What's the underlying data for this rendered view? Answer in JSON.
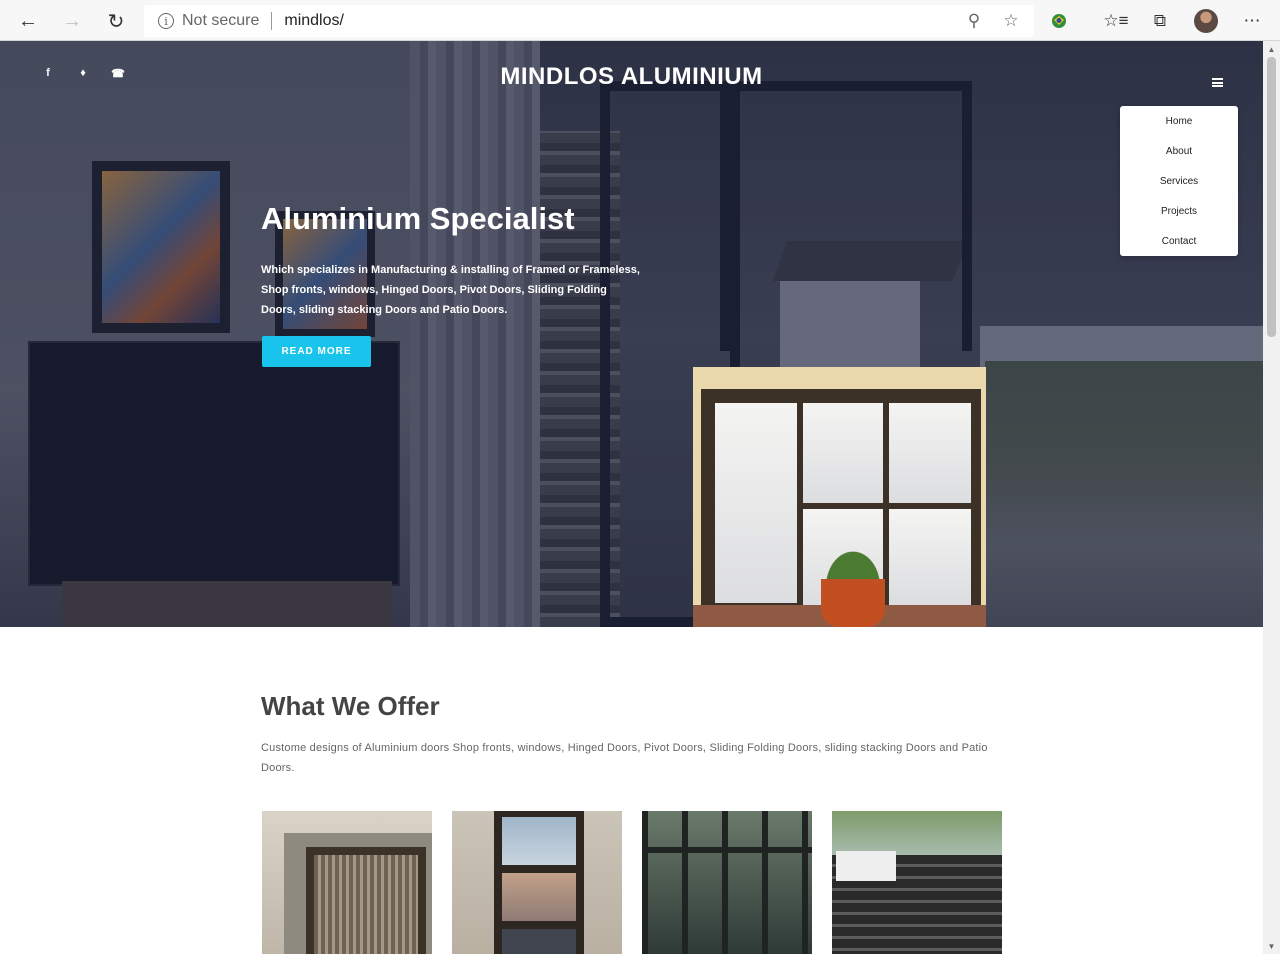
{
  "browser": {
    "security_label": "Not secure",
    "url": "mindlos/"
  },
  "site": {
    "brand": "MINDLOS ALUMINIUM",
    "social": [
      "facebook-icon",
      "twitter-icon",
      "whatsapp-icon"
    ],
    "menu": [
      "Home",
      "About",
      "Services",
      "Projects",
      "Contact"
    ]
  },
  "hero": {
    "title": "Aluminium Specialist",
    "text": "Which specializes in Manufacturing & installing of Framed or Frameless, Shop fronts, windows, Hinged Doors, Pivot Doors, Sliding Folding Doors, sliding stacking Doors and Patio Doors.",
    "button": "READ MORE",
    "button_color": "#19c4ec"
  },
  "offer": {
    "title": "What We Offer",
    "text": "Custome designs of Aluminium doors Shop fronts, windows, Hinged Doors, Pivot Doors, Sliding Folding Doors, sliding stacking Doors and Patio Doors."
  }
}
